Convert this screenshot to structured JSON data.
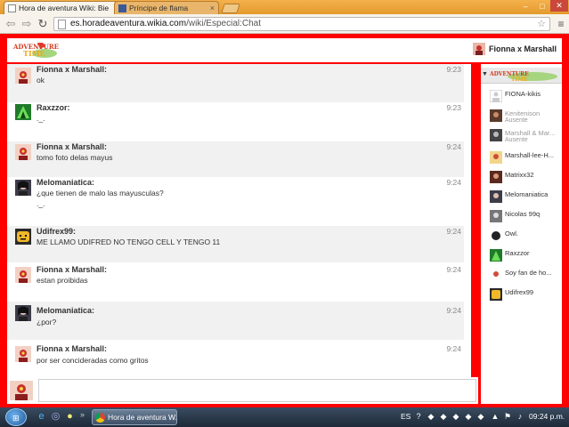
{
  "browser": {
    "tabs": [
      {
        "label": "Hora de aventura Wiki: Bie",
        "active": true
      },
      {
        "label": "Príncipe de flama",
        "active": false
      }
    ],
    "url_host": "es.horadeaventura.wikia.com",
    "url_path": "/wiki/Especial:Chat",
    "window_buttons": {
      "minimize": "–",
      "maximize": "□",
      "close": "✕"
    }
  },
  "chat": {
    "wiki_logo_text": "Adventure Time",
    "current_user": "Fionna x Marshall",
    "messages": [
      {
        "user": "Fionna x Marshall:",
        "time": "9:23",
        "lines": [
          "ok"
        ],
        "avatar": "fionna-avatar"
      },
      {
        "user": "Raxzzor:",
        "time": "9:23",
        "lines": [
          "._."
        ],
        "avatar": "raxzzor-avatar"
      },
      {
        "user": "Fionna x Marshall:",
        "time": "9:24",
        "lines": [
          "tomo foto delas mayus"
        ],
        "avatar": "fionna-avatar"
      },
      {
        "user": "Melomaniatica:",
        "time": "9:24",
        "lines": [
          "¿que tienen de malo las mayusculas?",
          "._."
        ],
        "avatar": "melomaniatica-avatar"
      },
      {
        "user": "Udifrex99:",
        "time": "9:24",
        "lines": [
          "ME LLAMO UDIFRED NO TENGO CELL Y TENGO 11"
        ],
        "avatar": "udifrex-avatar"
      },
      {
        "user": "Fionna x Marshall:",
        "time": "9:24",
        "lines": [
          "estan proibidas"
        ],
        "avatar": "fionna-avatar"
      },
      {
        "user": "Melomaniatica:",
        "time": "9:24",
        "lines": [
          "¿por?"
        ],
        "avatar": "melomaniatica-avatar"
      },
      {
        "user": "Fionna x Marshall:",
        "time": "9:24",
        "lines": [
          "por ser concideradas como gritos"
        ],
        "avatar": "fionna-avatar"
      }
    ],
    "users": [
      {
        "name": "FIONA-kikis",
        "status": ""
      },
      {
        "name": "Kenitenison",
        "status": "Ausente"
      },
      {
        "name": "Marshall & Mar...",
        "status": "Ausente"
      },
      {
        "name": "Marshall-lee-H...",
        "status": ""
      },
      {
        "name": "Matrixx32",
        "status": ""
      },
      {
        "name": "Melomaniatica",
        "status": ""
      },
      {
        "name": "Nicolas 99q",
        "status": ""
      },
      {
        "name": "Owl.",
        "status": ""
      },
      {
        "name": "Raxzzor",
        "status": ""
      },
      {
        "name": "Soy fan de ho...",
        "status": ""
      },
      {
        "name": "Udifrex99",
        "status": ""
      }
    ]
  },
  "taskbar": {
    "task_label": "Hora de aventura W...",
    "language": "ES",
    "clock": "09:24 p.m."
  },
  "colors": {
    "frame": "#ff0000",
    "chrome": "#f4b14c",
    "taskbar": "#1d2a38"
  }
}
